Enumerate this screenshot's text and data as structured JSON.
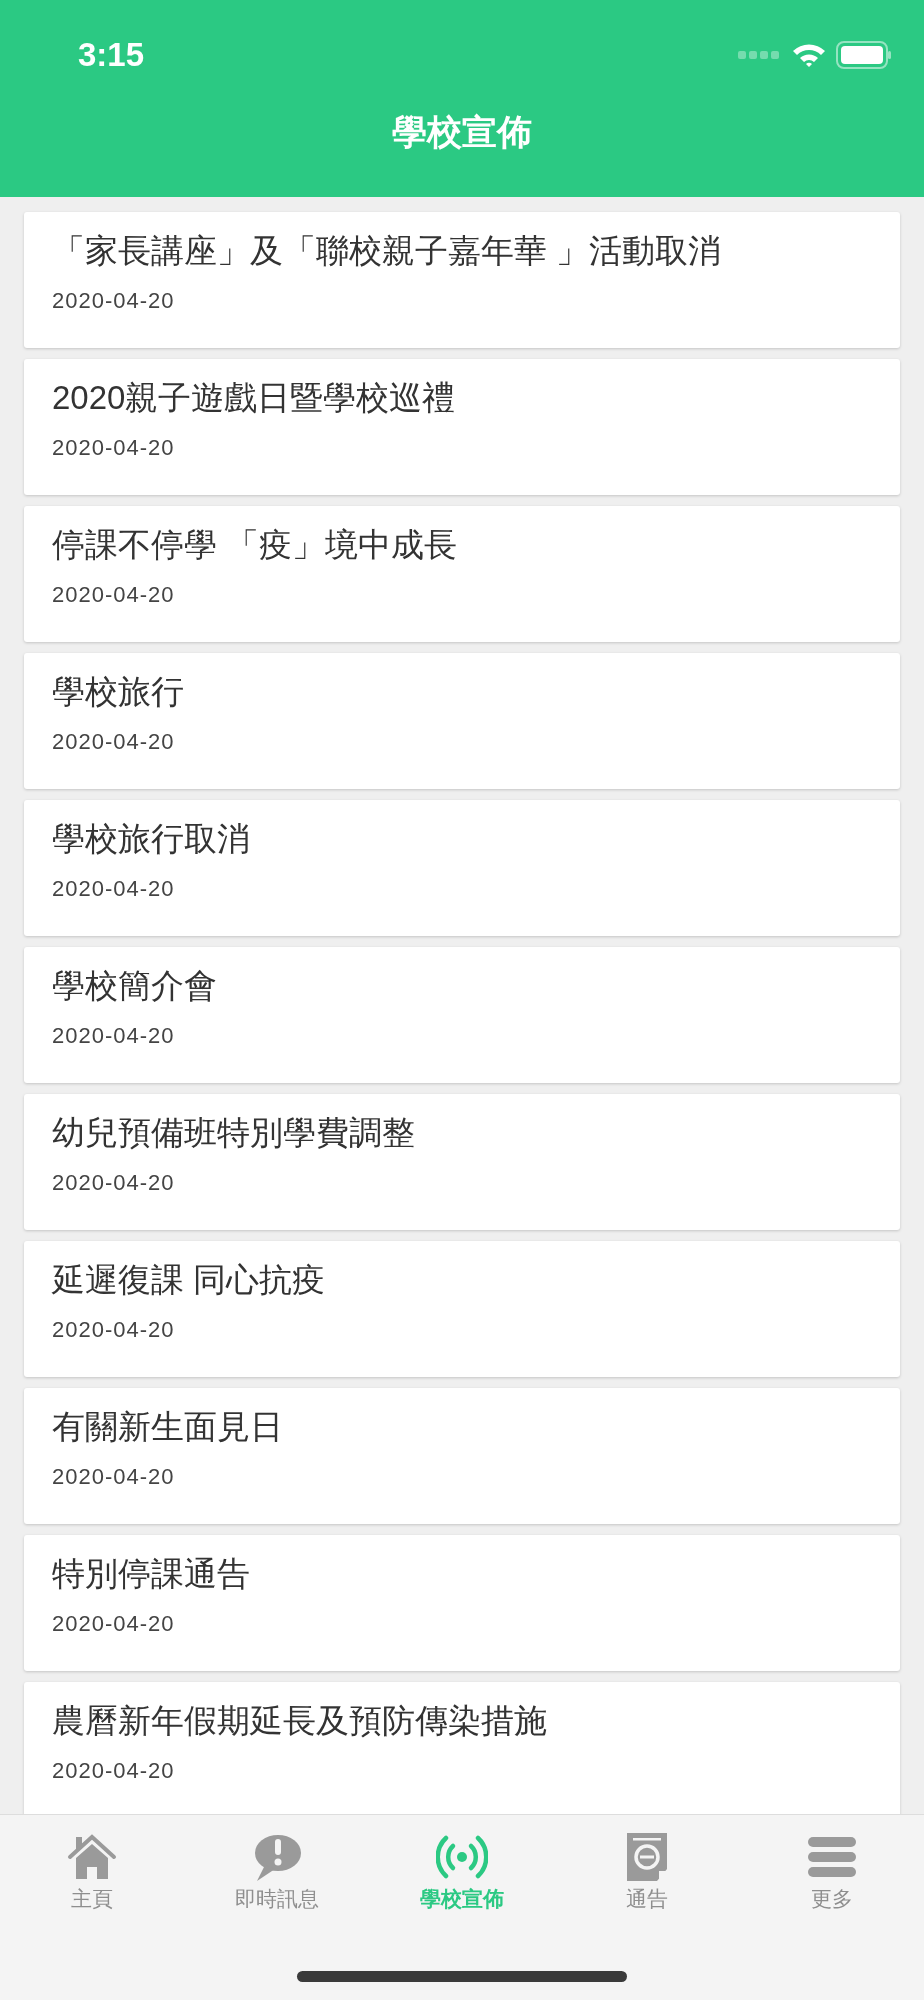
{
  "status_bar": {
    "time": "3:15"
  },
  "header": {
    "title": "學校宣佈"
  },
  "announcements": [
    {
      "title": "「家長講座」及「聯校親子嘉年華 」活動取消",
      "date": "2020-04-20"
    },
    {
      "title": "2020親子遊戲日暨學校巡禮",
      "date": "2020-04-20"
    },
    {
      "title": "停課不停學 「疫」境中成長",
      "date": "2020-04-20"
    },
    {
      "title": "學校旅行",
      "date": "2020-04-20"
    },
    {
      "title": "學校旅行取消",
      "date": "2020-04-20"
    },
    {
      "title": "學校簡介會",
      "date": "2020-04-20"
    },
    {
      "title": "幼兒預備班特別學費調整",
      "date": "2020-04-20"
    },
    {
      "title": "延遲復課 同心抗疫",
      "date": "2020-04-20"
    },
    {
      "title": "有關新生面見日",
      "date": "2020-04-20"
    },
    {
      "title": "特別停課通告",
      "date": "2020-04-20"
    },
    {
      "title": "農曆新年假期延長及預防傳染措施",
      "date": "2020-04-20"
    }
  ],
  "tab_bar": [
    {
      "label": "主頁",
      "selected": false
    },
    {
      "label": "即時訊息",
      "selected": false
    },
    {
      "label": "學校宣佈",
      "selected": true
    },
    {
      "label": "通告",
      "selected": false
    },
    {
      "label": "更多",
      "selected": false
    }
  ]
}
